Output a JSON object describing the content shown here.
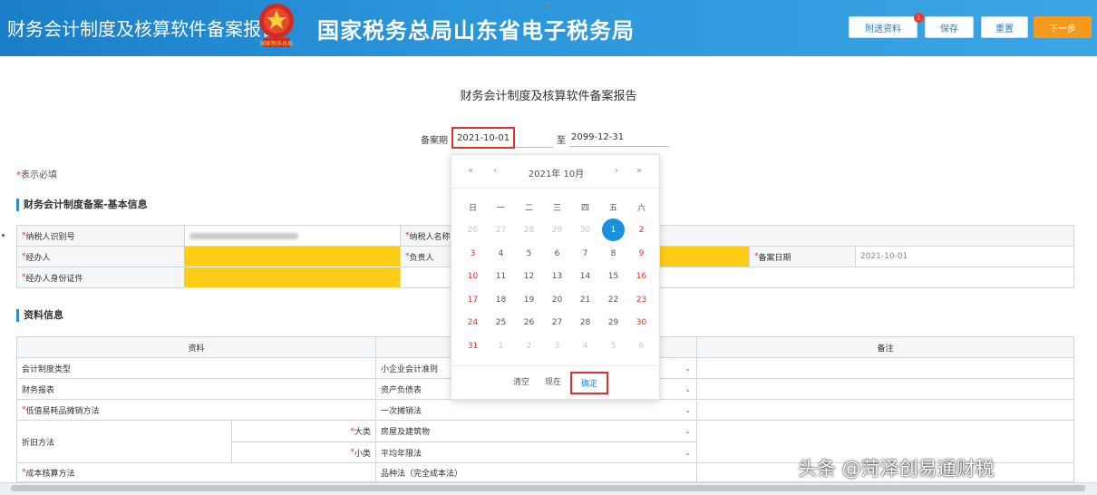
{
  "header": {
    "title": "财务会计制度及核算软件备案报告",
    "bureau": "国家税务总局山东省电子税务局",
    "emblem_label": "国家税务总局",
    "buttons": [
      {
        "label": "附送资料",
        "badge": "1"
      },
      {
        "label": "保存"
      },
      {
        "label": "重置"
      },
      {
        "label": "下一步"
      }
    ]
  },
  "page_title": "财务会计制度及核算软件备案报告",
  "period": {
    "label": "备案期",
    "start": "2021-10-01",
    "to_label": "至",
    "end": "2099-12-31"
  },
  "required_note": {
    "star": "*",
    "text": "表示必填"
  },
  "section_basic": {
    "title": "财务会计制度备案-基本信息",
    "taxpayer_id_label": "纳税人识别号",
    "taxpayer_name_label": "纳税人名称",
    "handler_label": "经办人",
    "principal_label": "负责人",
    "filing_date_label": "备案日期",
    "filing_date_value": "2021-10-01",
    "handler_id_label": "经办人身份证件"
  },
  "section_data": {
    "title": "资料信息",
    "headers": [
      "资料",
      "",
      "备注"
    ],
    "rows": [
      {
        "label": "会计制度类型",
        "value": "小企业会计准则"
      },
      {
        "label": "财务报表",
        "value": "资产负债表"
      },
      {
        "label": "低值易耗品摊销方法",
        "value": "一次摊销法"
      }
    ],
    "depreciation": {
      "label": "折旧方法",
      "big_label": "大类",
      "big_value": "房屋及建筑物",
      "small_label": "小类",
      "small_value": "平均年限法"
    },
    "last_row": {
      "label": "成本核算方法",
      "value": "品种法（完全成本法）"
    }
  },
  "calendar": {
    "month_label": "2021年 10月",
    "nav": {
      "prev_year": "«",
      "prev_month": "‹",
      "next_month": "›",
      "next_year": "»"
    },
    "weekdays": [
      "日",
      "一",
      "二",
      "三",
      "四",
      "五",
      "六"
    ],
    "days": [
      [
        "26",
        "27",
        "28",
        "29",
        "30",
        "1",
        "2"
      ],
      [
        "3",
        "4",
        "5",
        "6",
        "7",
        "8",
        "9"
      ],
      [
        "10",
        "11",
        "12",
        "13",
        "14",
        "15",
        "16"
      ],
      [
        "17",
        "18",
        "19",
        "20",
        "21",
        "22",
        "23"
      ],
      [
        "24",
        "25",
        "26",
        "27",
        "28",
        "29",
        "30"
      ],
      [
        "31",
        "1",
        "2",
        "3",
        "4",
        "5",
        "6"
      ]
    ],
    "selected": "1",
    "buttons": {
      "clear": "清空",
      "today": "现在",
      "ok": "确定"
    }
  },
  "watermark": "头条 @菏泽创易通财税",
  "colors": {
    "header_blue": "#1a7ec9",
    "highlight_yellow": "#ffcc16",
    "accent_red": "#e0322c",
    "select_blue": "#1b8fe0",
    "button_orange": "#f59a1c"
  }
}
